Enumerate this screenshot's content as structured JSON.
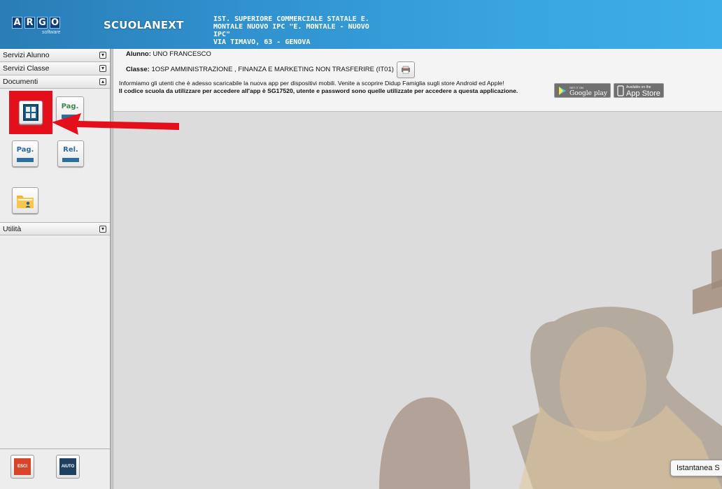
{
  "header": {
    "logo_letters": [
      "A",
      "R",
      "G",
      "O"
    ],
    "logo_sub": "software",
    "brand": "SCUOLANEXT",
    "school_lines": [
      "IST. SUPERIORE COMMERCIALE STATALE E.",
      "MONTALE NUOVO IPC \"E. MONTALE - NUOVO",
      "IPC\"",
      "VIA TIMAVO, 63 - GENOVA"
    ]
  },
  "sidebar": {
    "sections": [
      {
        "label": "Servizi Alunno"
      },
      {
        "label": "Servizi Classe"
      },
      {
        "label": "Documenti"
      }
    ],
    "documents": {
      "btn_pag_1": "Pag.",
      "btn_pag_2": "Pag.",
      "btn_rel": "Rel."
    },
    "utility_label": "Utilità",
    "exit_label": "ESCI",
    "help_label": "AIUTO"
  },
  "info": {
    "student_label": "Alunno:",
    "student_name": "UNO FRANCESCO",
    "class_label": "Classe:",
    "class_value": "1OSP AMMINISTRAZIONE , FINANZA E MARKETING NON TRASFERIRE (IT01)",
    "notice_line1": "Informiamo gli utenti che è adesso scaricabile la nuova app per dispositivi mobili. Venite a scoprire Didup Famiglia sugli store Android ed Apple!",
    "notice_line2": "Il codice scuola da utilizzare per accedere all'app è SG17520, utente e password sono quelle utilizzate per accedere a questa applicazione.",
    "google_play_small": "GET IT ON",
    "google_play": "Google play",
    "app_store_small": "Available on the",
    "app_store": "App Store"
  },
  "tooltip": "Istantanea S",
  "colors": {
    "header_blue": "#2f8fcc",
    "highlight_red": "#e3101c",
    "arrow_red": "#e3101c",
    "exit_red": "#d9452b",
    "help_navy": "#1e3f5e"
  }
}
